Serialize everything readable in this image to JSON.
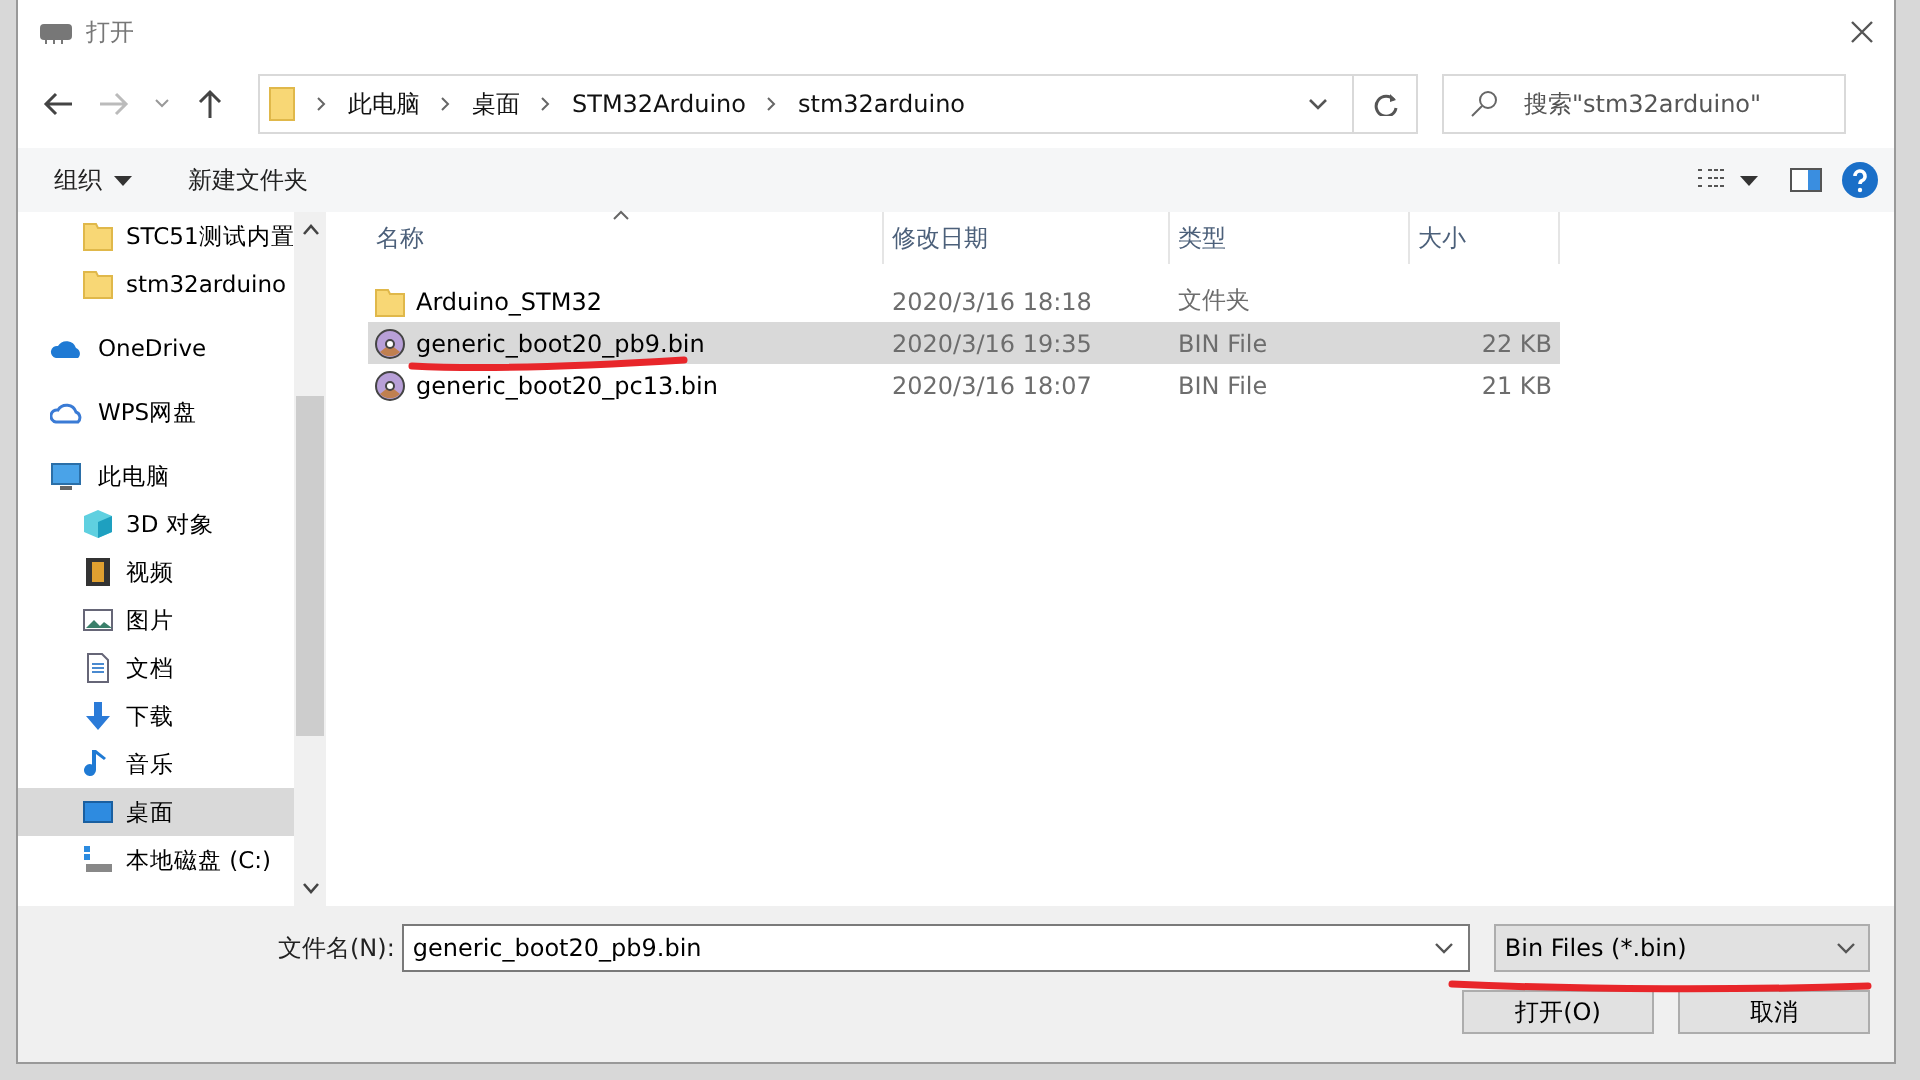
{
  "window": {
    "title": "打开"
  },
  "address": {
    "breadcrumbs": [
      "此电脑",
      "桌面",
      "STM32Arduino",
      "stm32arduino"
    ]
  },
  "search": {
    "placeholder": "搜索\"stm32arduino\""
  },
  "toolbar": {
    "organize": "组织",
    "new_folder": "新建文件夹"
  },
  "sidebar": {
    "items": [
      {
        "label": "STC51测试内置",
        "kind": "folder",
        "selected": false
      },
      {
        "label": "stm32arduino",
        "kind": "folder",
        "selected": false
      },
      {
        "label": "OneDrive",
        "kind": "cloud",
        "selected": false
      },
      {
        "label": "WPS网盘",
        "kind": "netdisk",
        "selected": false
      },
      {
        "label": "此电脑",
        "kind": "pc",
        "selected": false,
        "children": [
          {
            "label": "3D 对象",
            "kind": "cube",
            "selected": false
          },
          {
            "label": "视频",
            "kind": "video",
            "selected": false
          },
          {
            "label": "图片",
            "kind": "picture",
            "selected": false
          },
          {
            "label": "文档",
            "kind": "document",
            "selected": false
          },
          {
            "label": "下载",
            "kind": "download",
            "selected": false
          },
          {
            "label": "音乐",
            "kind": "music",
            "selected": false
          },
          {
            "label": "桌面",
            "kind": "desktop",
            "selected": true
          },
          {
            "label": "本地磁盘 (C:)",
            "kind": "drive",
            "selected": false
          }
        ]
      }
    ]
  },
  "table": {
    "columns": [
      "名称",
      "修改日期",
      "类型",
      "大小"
    ],
    "rows": [
      {
        "name": "Arduino_STM32",
        "date": "2020/3/16 18:18",
        "type": "文件夹",
        "kind": "folder",
        "selected": false
      },
      {
        "name": "generic_boot20_pb9.bin",
        "date": "2020/3/16 19:35",
        "type": "BIN File",
        "size": "22 KB",
        "kind": "bin",
        "selected": true
      },
      {
        "name": "generic_boot20_pc13.bin",
        "date": "2020/3/16 18:07",
        "type": "BIN File",
        "size": "21 KB",
        "kind": "bin",
        "selected": false
      }
    ]
  },
  "footer": {
    "filename_label": "文件名(N):",
    "filename": "generic_boot20_pb9.bin",
    "filetype": "Bin Files (*.bin)",
    "buttons": [
      "打开(O)",
      "取消"
    ]
  }
}
